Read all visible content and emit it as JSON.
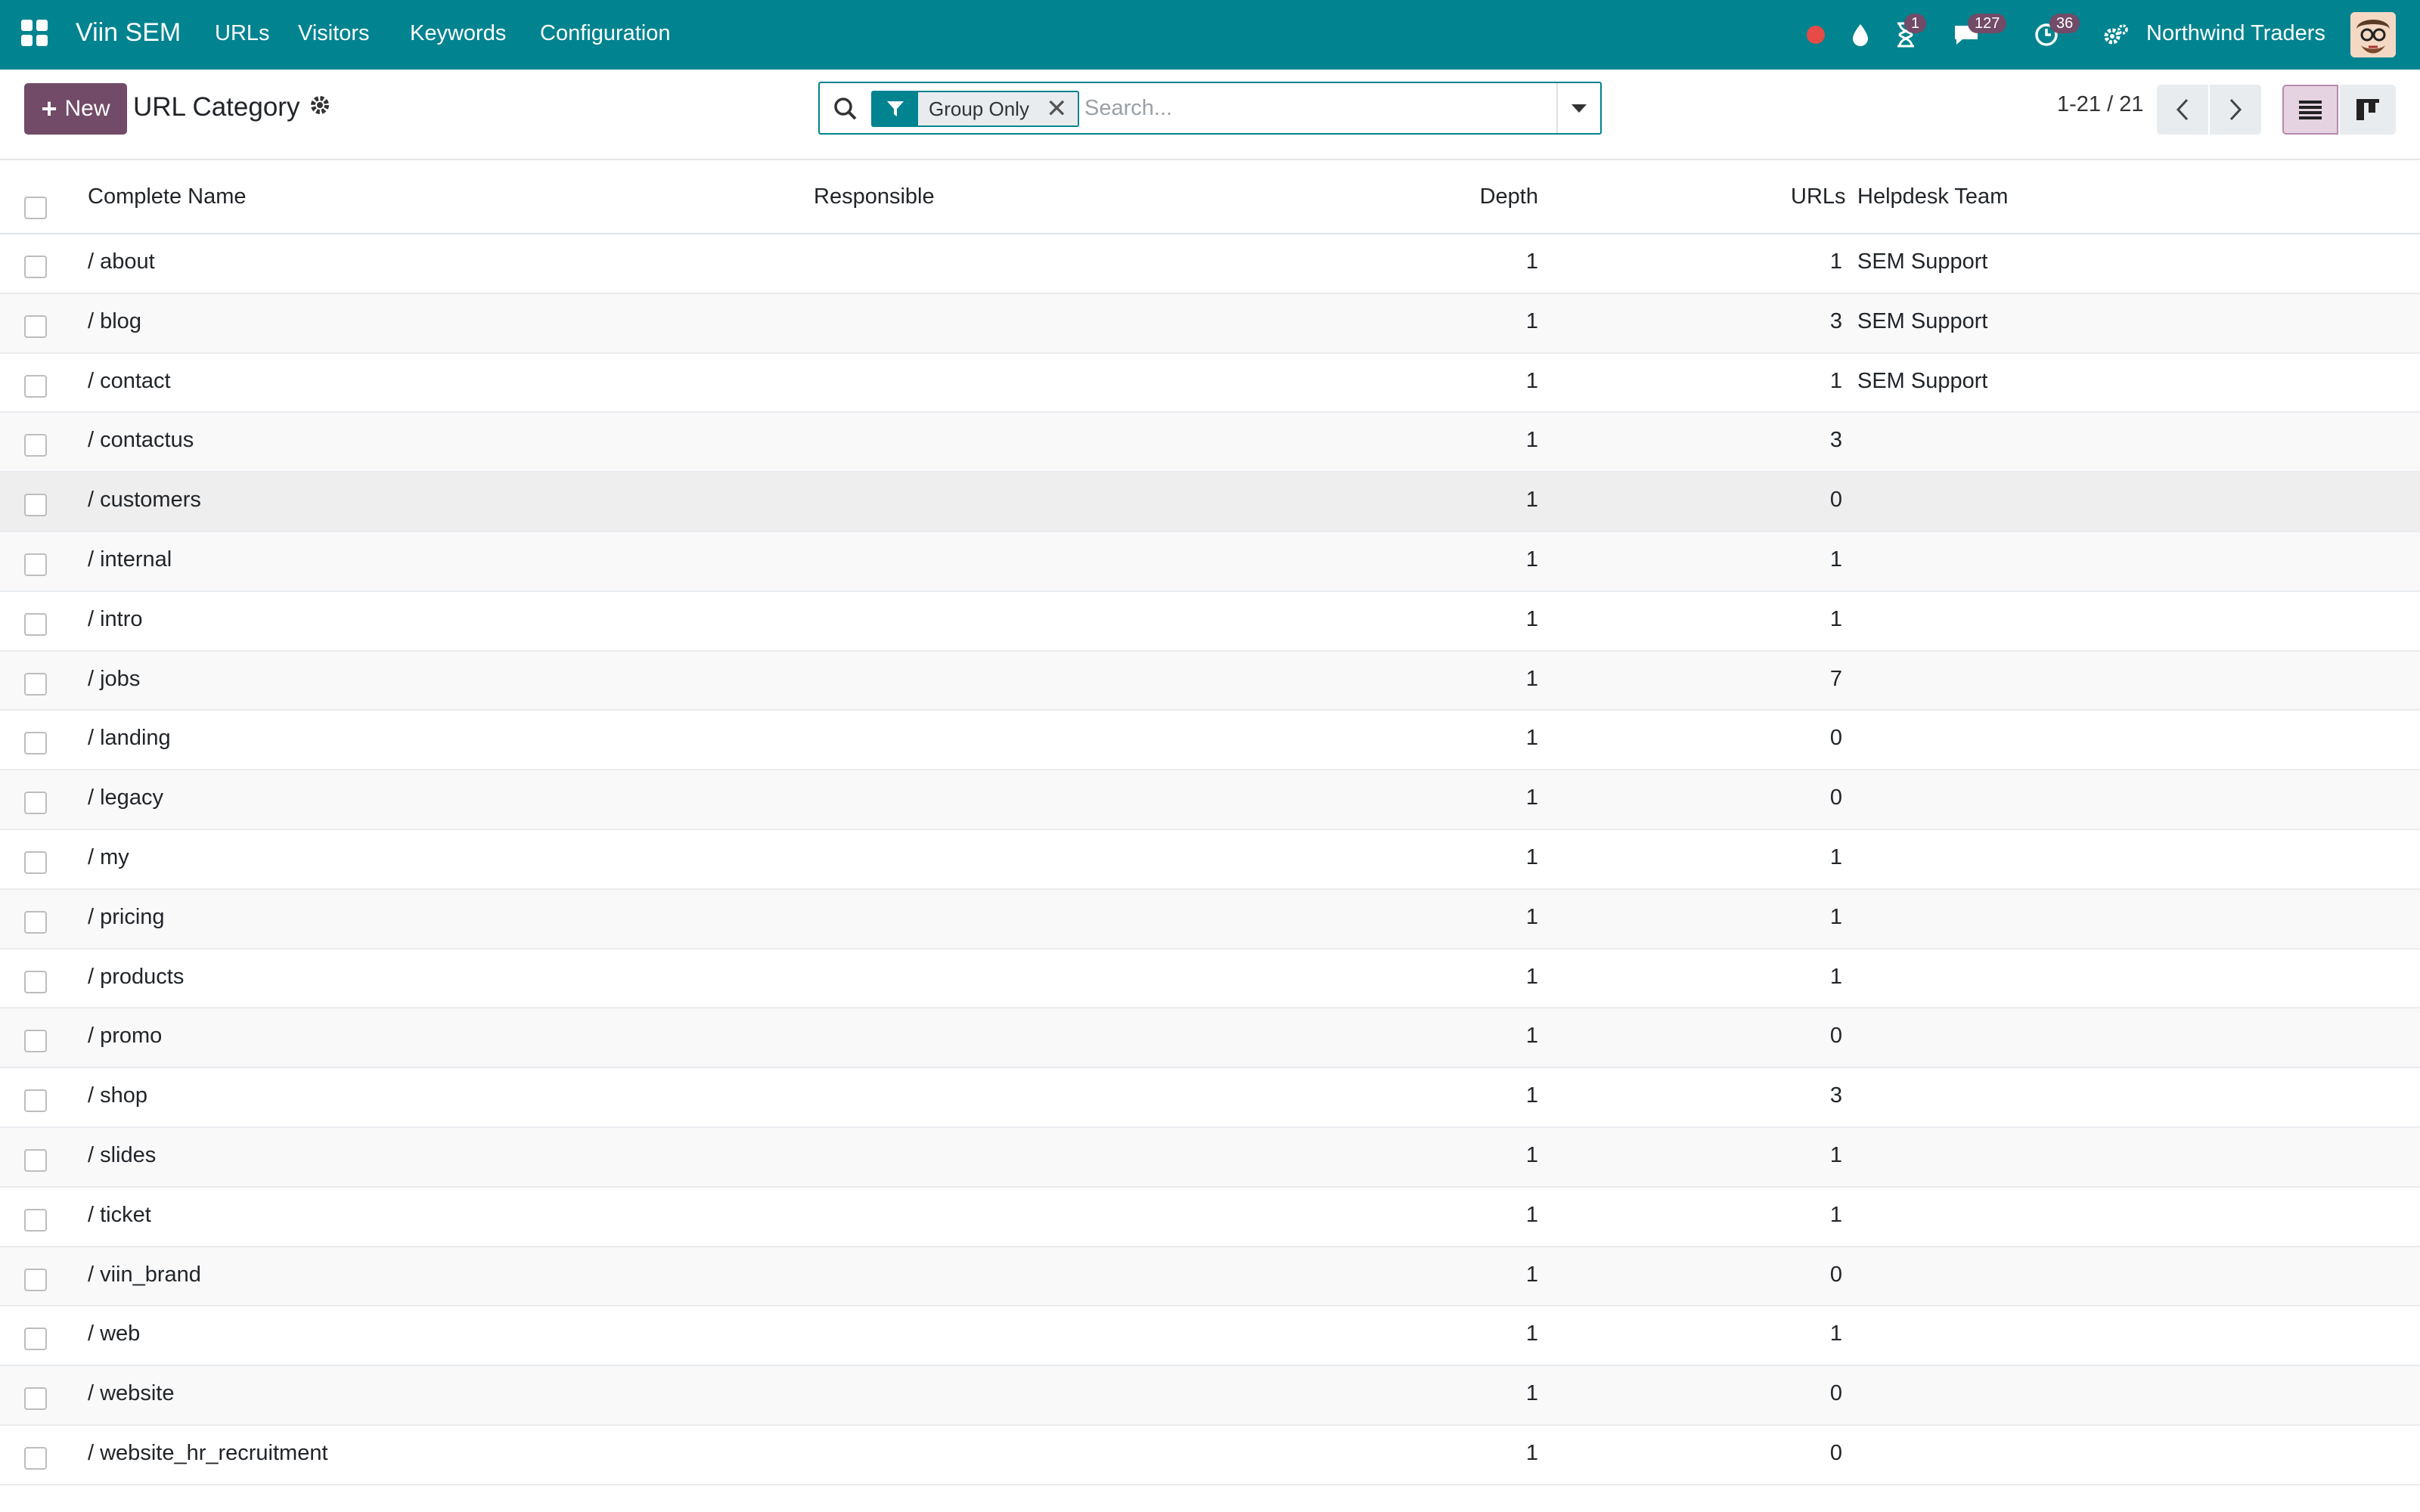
{
  "navbar": {
    "brand": "Viin SEM",
    "menus": [
      "URLs",
      "Visitors",
      "Keywords",
      "Configuration"
    ],
    "activity_badge": "1",
    "chat_badge": "127",
    "clock_badge": "36",
    "company": "Northwind Traders",
    "color": "#018390"
  },
  "control": {
    "new_label": "New",
    "title": "URL Category",
    "facet_value": "Group Only",
    "search_placeholder": "Search...",
    "pager": "1-21 / 21",
    "accent": "#714b67"
  },
  "table": {
    "headers": {
      "name": "Complete Name",
      "responsible": "Responsible",
      "depth": "Depth",
      "urls": "URLs",
      "team": "Helpdesk Team"
    },
    "rows": [
      {
        "name": "/ about",
        "responsible": "",
        "depth": "1",
        "urls": "1",
        "team": "SEM Support"
      },
      {
        "name": "/ blog",
        "responsible": "",
        "depth": "1",
        "urls": "3",
        "team": "SEM Support"
      },
      {
        "name": "/ contact",
        "responsible": "",
        "depth": "1",
        "urls": "1",
        "team": "SEM Support"
      },
      {
        "name": "/ contactus",
        "responsible": "",
        "depth": "1",
        "urls": "3",
        "team": ""
      },
      {
        "name": "/ customers",
        "responsible": "",
        "depth": "1",
        "urls": "0",
        "team": ""
      },
      {
        "name": "/ internal",
        "responsible": "",
        "depth": "1",
        "urls": "1",
        "team": ""
      },
      {
        "name": "/ intro",
        "responsible": "",
        "depth": "1",
        "urls": "1",
        "team": ""
      },
      {
        "name": "/ jobs",
        "responsible": "",
        "depth": "1",
        "urls": "7",
        "team": ""
      },
      {
        "name": "/ landing",
        "responsible": "",
        "depth": "1",
        "urls": "0",
        "team": ""
      },
      {
        "name": "/ legacy",
        "responsible": "",
        "depth": "1",
        "urls": "0",
        "team": ""
      },
      {
        "name": "/ my",
        "responsible": "",
        "depth": "1",
        "urls": "1",
        "team": ""
      },
      {
        "name": "/ pricing",
        "responsible": "",
        "depth": "1",
        "urls": "1",
        "team": ""
      },
      {
        "name": "/ products",
        "responsible": "",
        "depth": "1",
        "urls": "1",
        "team": ""
      },
      {
        "name": "/ promo",
        "responsible": "",
        "depth": "1",
        "urls": "0",
        "team": ""
      },
      {
        "name": "/ shop",
        "responsible": "",
        "depth": "1",
        "urls": "3",
        "team": ""
      },
      {
        "name": "/ slides",
        "responsible": "",
        "depth": "1",
        "urls": "1",
        "team": ""
      },
      {
        "name": "/ ticket",
        "responsible": "",
        "depth": "1",
        "urls": "1",
        "team": ""
      },
      {
        "name": "/ viin_brand",
        "responsible": "",
        "depth": "1",
        "urls": "0",
        "team": ""
      },
      {
        "name": "/ web",
        "responsible": "",
        "depth": "1",
        "urls": "1",
        "team": ""
      },
      {
        "name": "/ website",
        "responsible": "",
        "depth": "1",
        "urls": "0",
        "team": ""
      },
      {
        "name": "/ website_hr_recruitment",
        "responsible": "",
        "depth": "1",
        "urls": "0",
        "team": ""
      }
    ]
  }
}
